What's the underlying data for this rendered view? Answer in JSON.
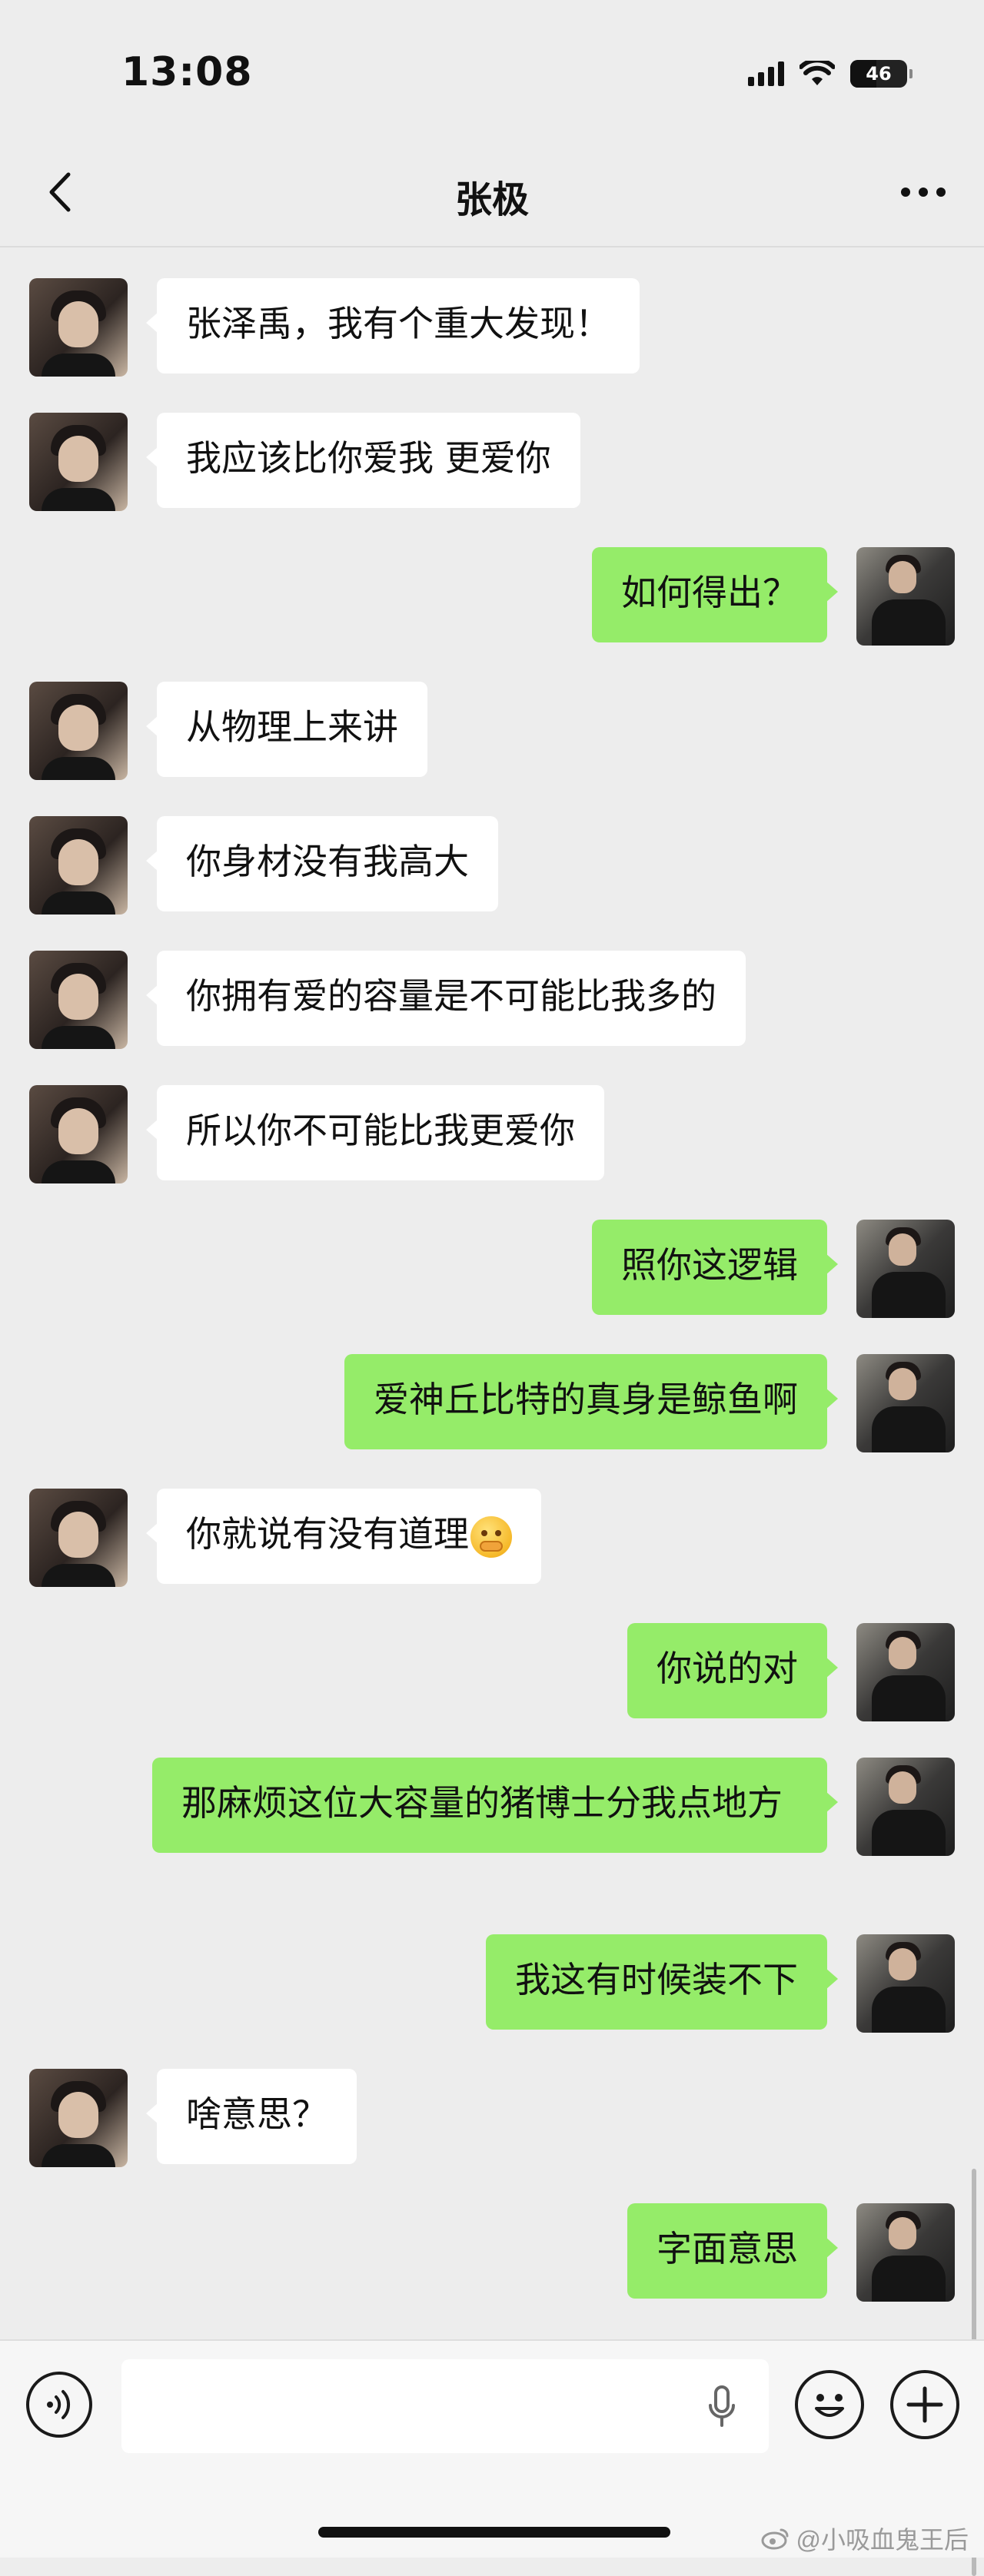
{
  "status": {
    "time": "13:08",
    "battery_level": "46",
    "icons": [
      "signal-icon",
      "wifi-icon",
      "battery-icon"
    ]
  },
  "nav": {
    "title": "张极",
    "icons": [
      "chevron-left-icon",
      "more-icon"
    ]
  },
  "messages": [
    {
      "side": "left",
      "text": "张泽禹，我有个重大发现！"
    },
    {
      "side": "left",
      "text": "我应该比你爱我 更爱你"
    },
    {
      "side": "right",
      "text": "如何得出？"
    },
    {
      "side": "left",
      "text": "从物理上来讲"
    },
    {
      "side": "left",
      "text": "你身材没有我高大"
    },
    {
      "side": "left",
      "text": "你拥有爱的容量是不可能比我多的"
    },
    {
      "side": "left",
      "text": "所以你不可能比我更爱你"
    },
    {
      "side": "right",
      "text": "照你这逻辑"
    },
    {
      "side": "right",
      "text": "爱神丘比特的真身是鲸鱼啊"
    },
    {
      "side": "left",
      "text": "你就说有没有道理",
      "emoji": "hand-over-mouth-emoji"
    },
    {
      "side": "right",
      "text": "你说的对"
    },
    {
      "side": "right",
      "text": "那麻烦这位大容量的猪博士分我点地方"
    },
    {
      "side": "right",
      "text": "我这有时候装不下"
    },
    {
      "side": "left",
      "text": "啥意思？"
    },
    {
      "side": "right",
      "text": "字面意思"
    }
  ],
  "input_bar": {
    "text_value": "",
    "icons": [
      "voice-icon",
      "microphone-icon",
      "emoji-icon",
      "plus-icon"
    ]
  },
  "watermark": {
    "text": "@小吸血鬼王后",
    "icon": "weibo-icon"
  },
  "colors": {
    "background": "#ededed",
    "sent_bubble": "#95ec69",
    "received_bubble": "#ffffff"
  }
}
